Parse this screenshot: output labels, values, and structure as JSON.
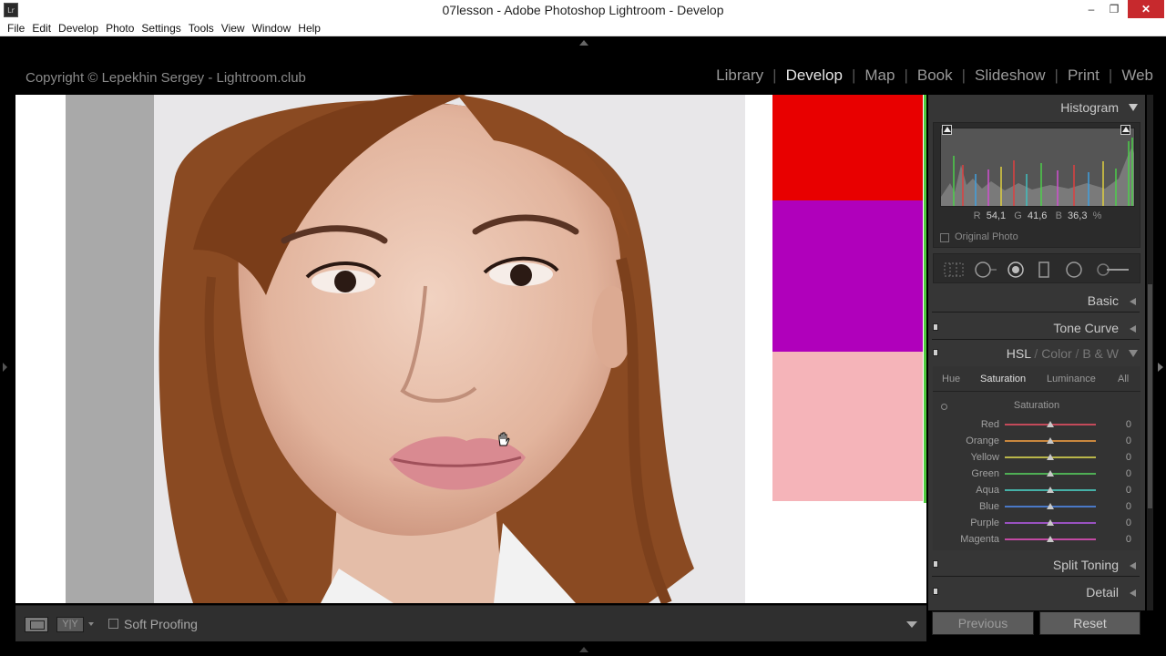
{
  "window": {
    "title": "07lesson - Adobe Photoshop Lightroom - Develop",
    "app_icon": "Lr",
    "minimize": "–",
    "maximize": "❐",
    "close": "✕"
  },
  "menu": [
    "File",
    "Edit",
    "Develop",
    "Photo",
    "Settings",
    "Tools",
    "View",
    "Window",
    "Help"
  ],
  "identity_plate": "Copyright © Lepekhin Sergey - Lightroom.club",
  "modules": {
    "library": "Library",
    "develop": "Develop",
    "map": "Map",
    "book": "Book",
    "slideshow": "Slideshow",
    "print": "Print",
    "web": "Web",
    "active": "Develop"
  },
  "swatches": {
    "red": "#e80000",
    "purple": "#b000bb",
    "pink": "#f5b4b9"
  },
  "toolbar": {
    "yy_label": "Y|Y",
    "soft_proofing": "Soft Proofing"
  },
  "right_panel": {
    "histogram": {
      "title": "Histogram",
      "r_label": "R",
      "r_value": "54,1",
      "g_label": "G",
      "g_value": "41,6",
      "b_label": "B",
      "b_value": "36,3",
      "unit": "%",
      "original_photo": "Original Photo"
    },
    "basic": "Basic",
    "tone_curve": "Tone Curve",
    "hsl_header": {
      "hsl": "HSL",
      "sep1": "/",
      "color": "Color",
      "sep2": "/",
      "bw": "B & W"
    },
    "hsl_tabs": {
      "hue": "Hue",
      "saturation": "Saturation",
      "luminance": "Luminance",
      "all": "All"
    },
    "saturation_title": "Saturation",
    "saturation_sliders": [
      {
        "name": "Red",
        "value": "0",
        "color": "#c34a5a"
      },
      {
        "name": "Orange",
        "value": "0",
        "color": "#c9873e"
      },
      {
        "name": "Yellow",
        "value": "0",
        "color": "#b9b64a"
      },
      {
        "name": "Green",
        "value": "0",
        "color": "#4fae55"
      },
      {
        "name": "Aqua",
        "value": "0",
        "color": "#45b1a8"
      },
      {
        "name": "Blue",
        "value": "0",
        "color": "#4a78c7"
      },
      {
        "name": "Purple",
        "value": "0",
        "color": "#9a52c0"
      },
      {
        "name": "Magenta",
        "value": "0",
        "color": "#c24aa3"
      }
    ],
    "split_toning": "Split Toning",
    "detail": "Detail",
    "previous": "Previous",
    "reset": "Reset"
  }
}
